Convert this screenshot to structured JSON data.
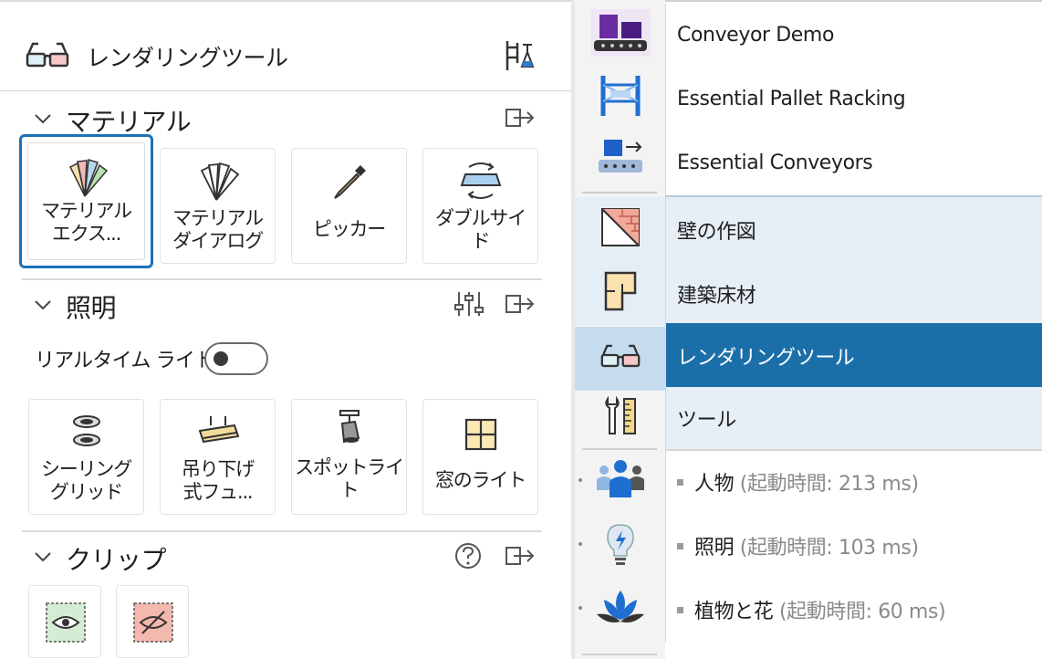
{
  "panel": {
    "title": "レンダリングツール"
  },
  "sections": {
    "material": {
      "title": "マテリアル"
    },
    "lighting": {
      "title": "照明",
      "realtime_label": "リアルタイム ライト"
    },
    "clip": {
      "title": "クリップ"
    }
  },
  "material_tiles": [
    {
      "line1": "マテリアル",
      "line2": "エクス..."
    },
    {
      "line1": "マテリアル",
      "line2": "ダイアログ"
    },
    {
      "line1": "ピッカー"
    },
    {
      "line1": "ダブルサイ",
      "line2": "ド"
    }
  ],
  "lighting_tiles": [
    {
      "line1": "シーリング",
      "line2": "グリッド"
    },
    {
      "line1": "吊り下げ",
      "line2": "式フュ..."
    },
    {
      "line1": "スポットライ",
      "line2": "ト"
    },
    {
      "line1": "窓のライト"
    }
  ],
  "list": {
    "items": [
      {
        "label": "Conveyor Demo"
      },
      {
        "label": "Essential Pallet Racking"
      },
      {
        "label": "Essential Conveyors"
      },
      {
        "label": "壁の作図"
      },
      {
        "label": "建築床材"
      },
      {
        "label": "レンダリングツール"
      },
      {
        "label": "ツール"
      },
      {
        "label": "人物",
        "meta": "(起動時間: 213 ms)"
      },
      {
        "label": "照明",
        "meta": "(起動時間: 103 ms)"
      },
      {
        "label": "植物と花",
        "meta": "(起動時間: 60 ms)"
      }
    ]
  },
  "icons": {
    "panel_header": "render-glasses-icon",
    "panel_header_right": "pin-tool-icon",
    "chevron": "chevron-down-icon",
    "exit": "exit-arrow-icon",
    "tune": "slider-settings-icon",
    "help": "help-circle-icon"
  },
  "colors": {
    "accent": "#1b6fa8",
    "selected_outline": "#1b72b8",
    "light_row": "#e6eef6",
    "icon_active_bg": "#c5dbee"
  }
}
